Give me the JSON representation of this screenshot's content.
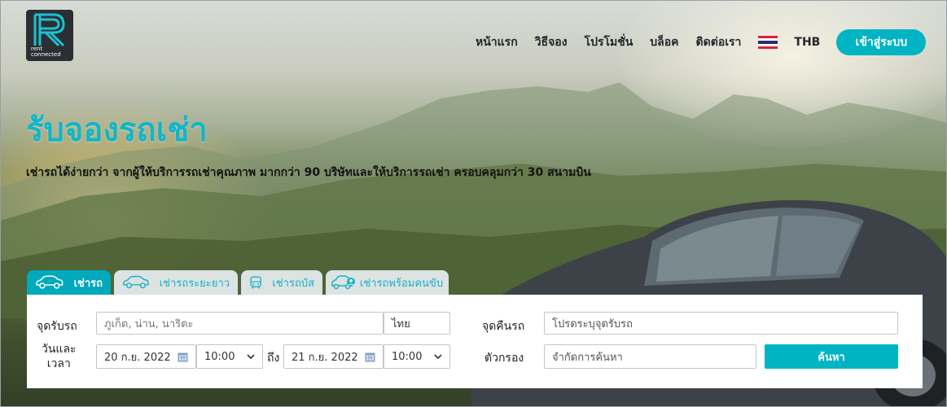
{
  "brand": {
    "logo_letter": "R",
    "logo_line1": "rent",
    "logo_line2": "connected"
  },
  "nav": {
    "items": [
      "หน้าแรก",
      "วิธีจอง",
      "โปรโมชั่น",
      "บล็อค",
      "ติดต่อเรา"
    ],
    "language_flag": "thailand-flag-icon",
    "currency": "THB",
    "login_label": "เข้าสู่ระบบ"
  },
  "hero": {
    "title": "รับจองรถเช่า",
    "subtitle": "เช่ารถได้ง่ายกว่า จากผู้ให้บริการรถเช่าคุณภาพ มากกว่า 90 บริษัทและให้บริการรถเช่า ครอบคลุมกว่า 30 สนามบิน"
  },
  "tabs": [
    {
      "label": "เช่ารถ",
      "icon": "car-icon",
      "active": true
    },
    {
      "label": "เช่ารถระยะยาว",
      "icon": "car-outline-icon",
      "active": false
    },
    {
      "label": "เช่ารถบัส",
      "icon": "bus-icon",
      "active": false
    },
    {
      "label": "เช่ารถพร้อมคนขับ",
      "icon": "car-driver-icon",
      "active": false
    }
  ],
  "form": {
    "pickup_label": "จุดรับรถ",
    "pickup_placeholder": "ภูเก็ต, น่าน, นาริตะ",
    "country_value": "ไทย",
    "return_label": "จุดคืนรถ",
    "return_placeholder": "โปรดระบุจุดรับรถ",
    "datetime_label_line1": "วันและ",
    "datetime_label_line2": "เวลา",
    "pickup_date": "20 ก.ย. 2022",
    "pickup_time": "10:00",
    "to_label": "ถึง",
    "return_date": "21 ก.ย. 2022",
    "return_time": "10:00",
    "filter_label": "ตัวกรอง",
    "filter_placeholder": "จำกัดการค้นหา",
    "search_label": "ค้นหา"
  },
  "colors": {
    "accent": "#00b4c4",
    "title": "#12b5c6",
    "tab_inactive": "#dde2e3"
  }
}
